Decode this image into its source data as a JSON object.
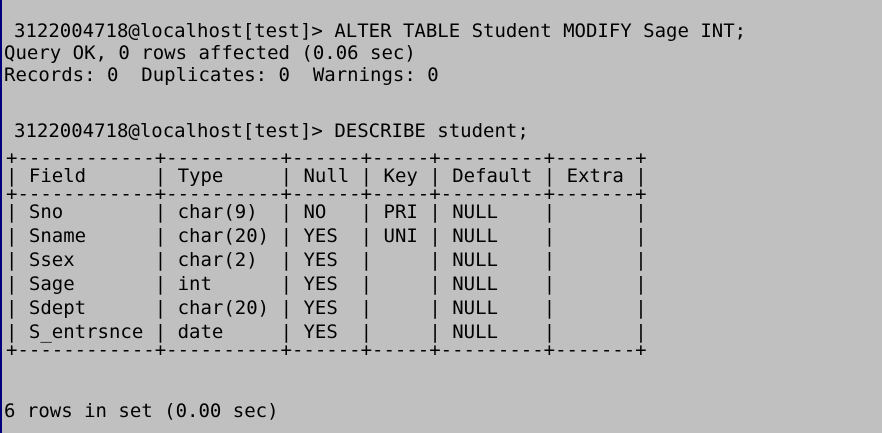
{
  "session": {
    "prompt_1": "3122004718@localhost[test]>",
    "command_1": "ALTER TABLE Student MODIFY Sage INT;",
    "result_1_line_1": "Query OK, 0 rows affected (0.06 sec)",
    "result_1_line_2": "Records: 0  Duplicates: 0  Warnings: 0",
    "prompt_2": "3122004718@localhost[test]>",
    "command_2": "DESCRIBE student;",
    "footer": "6 rows in set (0.00 sec)"
  },
  "table": {
    "border": "+------------+----------+------+-----+---------+-------+",
    "columns": [
      "Field",
      "Type",
      "Null",
      "Key",
      "Default",
      "Extra"
    ],
    "rows": [
      [
        "Sno",
        "char(9)",
        "NO",
        "PRI",
        "NULL",
        ""
      ],
      [
        "Sname",
        "char(20)",
        "YES",
        "UNI",
        "NULL",
        ""
      ],
      [
        "Ssex",
        "char(2)",
        "YES",
        "",
        "NULL",
        ""
      ],
      [
        "Sage",
        "int",
        "YES",
        "",
        "NULL",
        ""
      ],
      [
        "Sdept",
        "char(20)",
        "YES",
        "",
        "NULL",
        ""
      ],
      [
        "S_entrsnce",
        "date",
        "YES",
        "",
        "NULL",
        ""
      ]
    ]
  }
}
